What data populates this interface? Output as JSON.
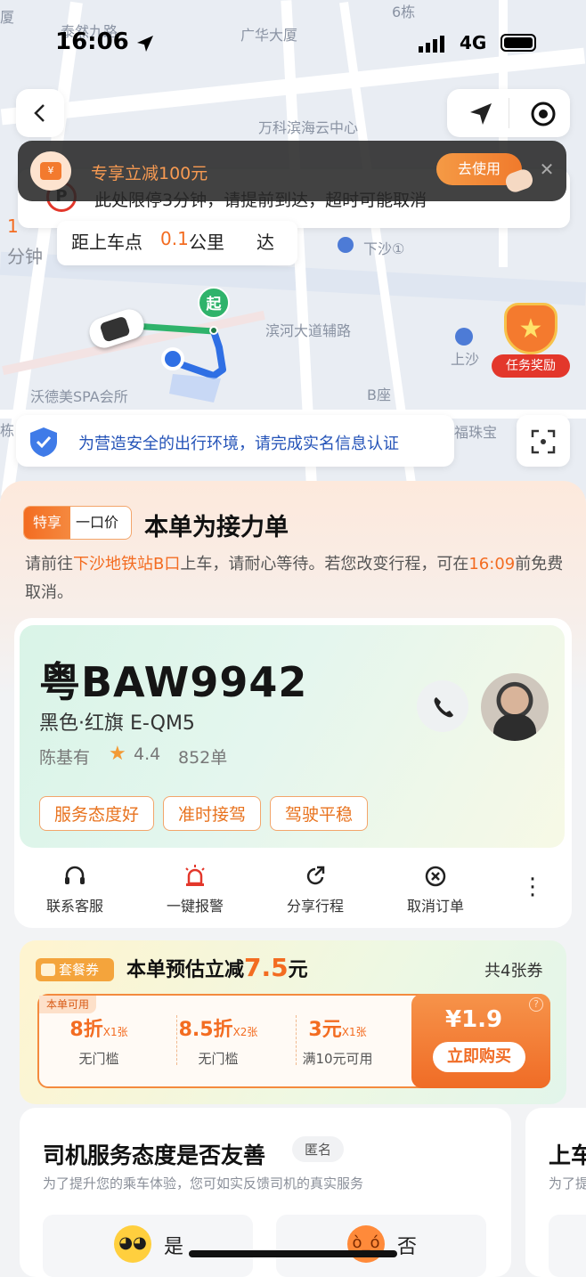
{
  "status_bar": {
    "time": "16:06",
    "network": "4G"
  },
  "map": {
    "labels": [
      "泰然九路",
      "广华大厦",
      "6栋",
      "厦",
      "万科滨海云中心",
      "下沙①",
      "滨河大道辅路",
      "上沙",
      "沃德美SPA会所",
      "B座",
      "福珠宝",
      "栋"
    ],
    "pickup_marker": "起",
    "parking_note": "此处限停3分钟，请提前到达，超时可能取消",
    "eta_unit": "分钟",
    "eta_number": "1",
    "distance_prefix": "距上车点",
    "distance_value": "0.1",
    "distance_unit": "公里",
    "arrive_suffix": "达",
    "reward_badge": "任务奖励",
    "verify_banner": "为营造安全的出行环境，请完成实名信息认证"
  },
  "promo": {
    "title": "专享立减100元",
    "button": "去使用"
  },
  "trip": {
    "tag_special": "特享",
    "tag_price": "一口价",
    "title": "本单为接力单",
    "desc_pre": "请前往",
    "desc_place": "下沙地铁站B口",
    "desc_mid": "上车，请耐心等待。若您改变行程，可在",
    "desc_time": "16:09",
    "desc_post": "前免费取消。"
  },
  "driver": {
    "plate": "粤BAW9942",
    "car": "黑色·红旗 E-QM5",
    "name": "陈基有",
    "rating": "4.4",
    "orders": "852单",
    "tags": [
      "服务态度好",
      "准时接驾",
      "驾驶平稳"
    ]
  },
  "actions": [
    {
      "label": "联系客服",
      "icon": "headset-icon"
    },
    {
      "label": "一键报警",
      "icon": "alarm-icon"
    },
    {
      "label": "分享行程",
      "icon": "share-icon"
    },
    {
      "label": "取消订单",
      "icon": "cancel-icon"
    }
  ],
  "package": {
    "badge": "套餐券",
    "title_pre": "本单预估立减",
    "amount": "7.5",
    "unit": "元",
    "count": "共4张券",
    "usable_tag": "本单可用",
    "items": [
      {
        "value": "8折",
        "qty": "X1张",
        "cond": "无门槛"
      },
      {
        "value": "8.5折",
        "qty": "X2张",
        "cond": "无门槛"
      },
      {
        "value": "3元",
        "qty": "X1张",
        "cond": "满10元可用"
      }
    ],
    "price": "¥1.9",
    "buy_button": "立即购买"
  },
  "feedback": {
    "title": "司机服务态度是否友善",
    "anon": "匿名",
    "desc": "为了提升您的乘车体验，您可如实反馈司机的真实服务",
    "yes": "是",
    "no": "否",
    "next_title": "上车",
    "next_desc": "为了提"
  },
  "colors": {
    "accent": "#f36c21",
    "brand_blue": "#2f6fe4",
    "green": "#2fb36b"
  }
}
